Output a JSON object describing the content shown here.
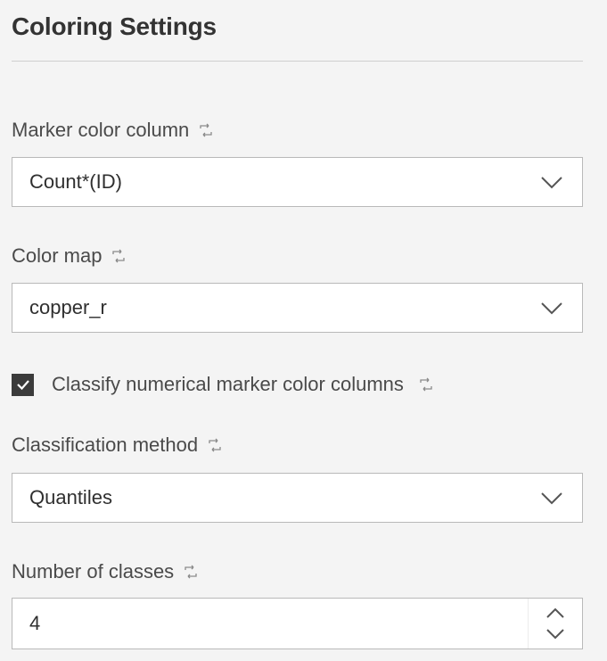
{
  "title": "Coloring Settings",
  "marker_color": {
    "label": "Marker color column",
    "value": "Count*(ID)"
  },
  "color_map": {
    "label": "Color map",
    "value": "copper_r"
  },
  "classify": {
    "label": "Classify numerical marker color columns",
    "checked": true
  },
  "classification_method": {
    "label": "Classification method",
    "value": "Quantiles"
  },
  "num_classes": {
    "label": "Number of classes",
    "value": "4"
  },
  "colors": {
    "background": "#f4f4f4",
    "checkbox": "#3b3b3b",
    "border": "#b9b9b9"
  },
  "icons": {
    "link": "link-icon",
    "dropdown": "chevron-down-icon",
    "step_up": "chevron-up-icon",
    "step_down": "chevron-down-icon",
    "check": "checkmark-icon"
  }
}
